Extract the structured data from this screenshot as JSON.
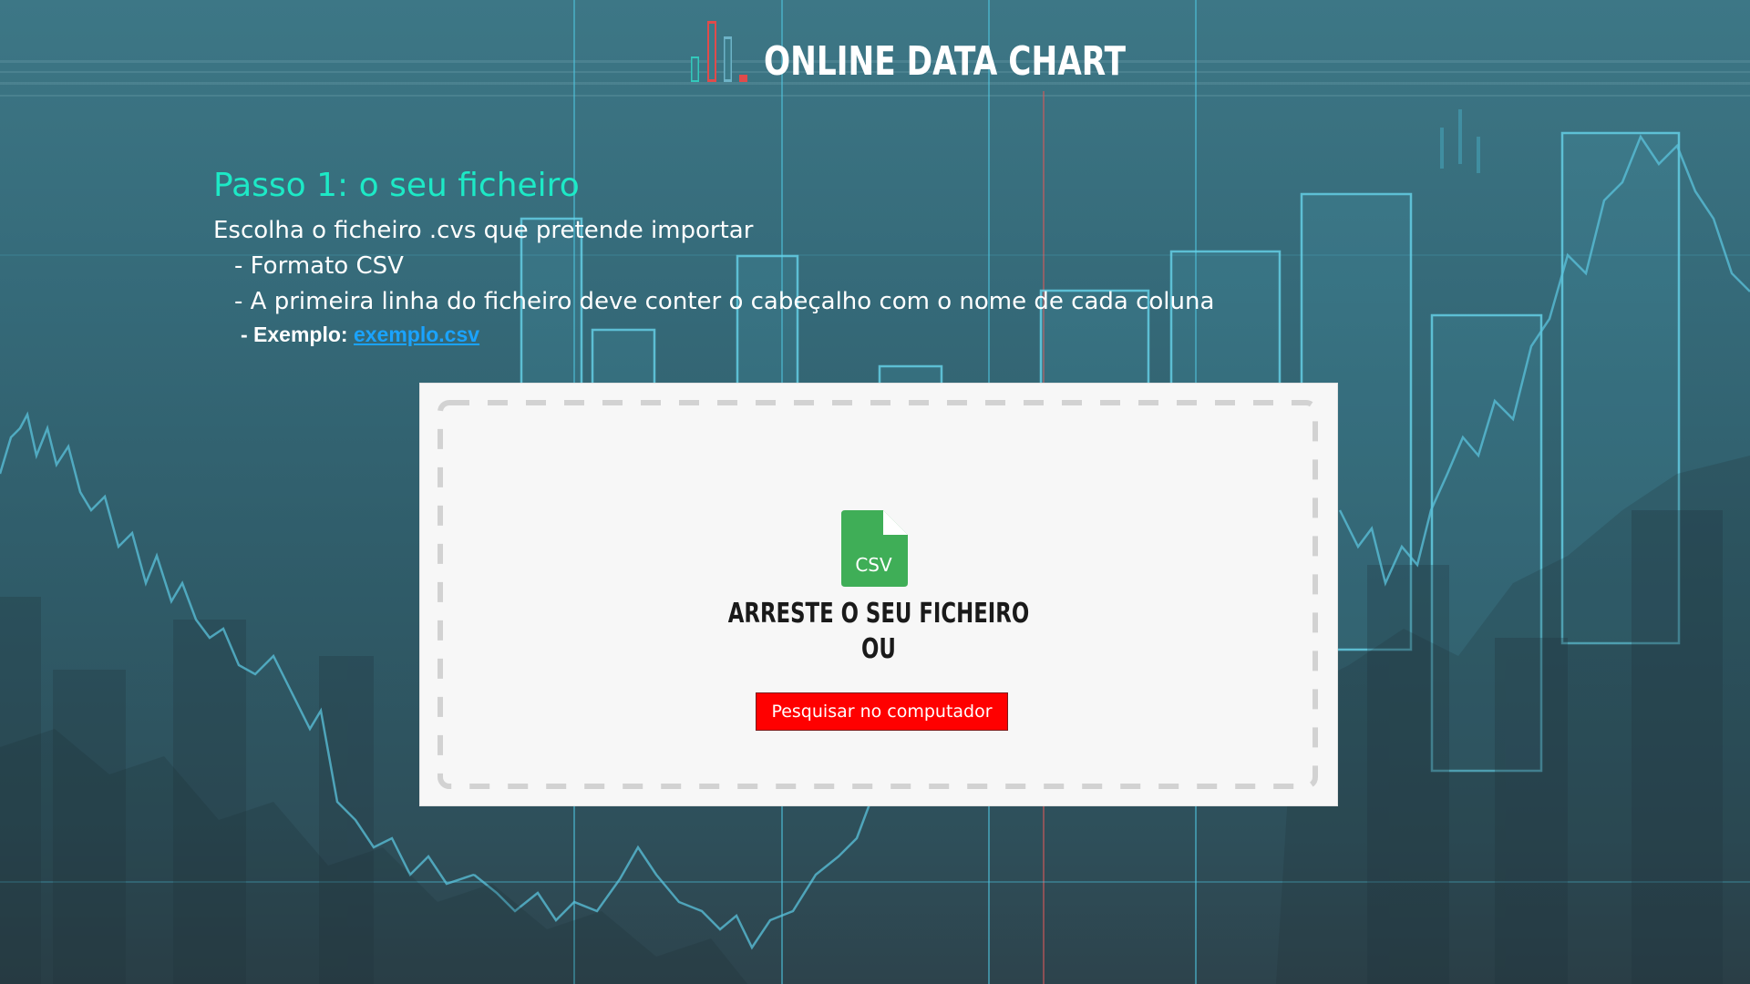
{
  "app": {
    "logo_text": "ONLINE DATA CHART"
  },
  "intro": {
    "step_title": "Passo 1: o seu ficheiro",
    "description": "Escolha o ficheiro .cvs que pretende importar",
    "requirements": [
      "- Formato CSV",
      "- A primeira linha do ficheiro deve conter o cabeçalho com o nome de cada coluna"
    ],
    "example_label": "- Exemplo: ",
    "example_link": "exemplo.csv"
  },
  "dropzone": {
    "file_icon": "csv-file-icon",
    "file_icon_label": "CSV",
    "drop_text": "ARRESTE O SEU FICHEIRO",
    "or_text": "OU",
    "browse_button": "Pesquisar no computador"
  },
  "colors": {
    "accent_title": "#1de9c6",
    "link": "#1aa3ff",
    "button": "#ff0000",
    "csv_icon": "#3fae57",
    "background": "#356a79"
  }
}
